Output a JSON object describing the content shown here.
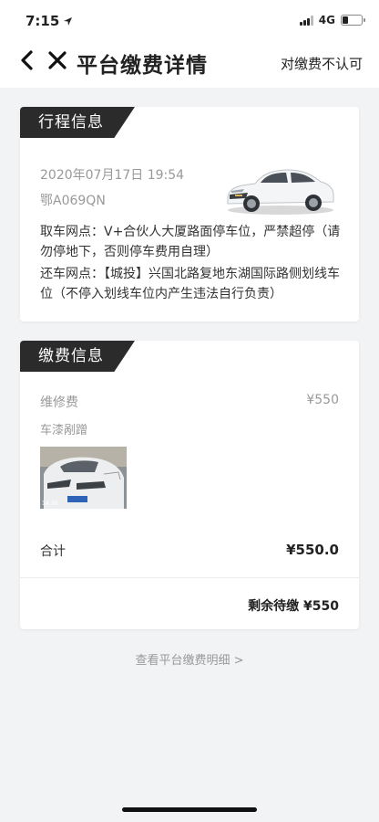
{
  "status_bar": {
    "time": "7:15",
    "network": "4G"
  },
  "nav": {
    "title": "平台缴费详情",
    "action": "对缴费不认可"
  },
  "trip": {
    "section_title": "行程信息",
    "datetime": "2020年07月17日 19:54",
    "plate": "鄂A069QN",
    "pickup": "取车网点：V+合伙人大厦路面停车位，严禁超停（请勿停地下，否则停车费用自理）",
    "return": "还车网点：【城投】兴国北路复地东湖国际路侧划线车位（不停入划线车位内产生违法自行负责）"
  },
  "payment": {
    "section_title": "缴费信息",
    "repair_label": "维修费",
    "repair_value": "¥550",
    "damage_label": "车漆剐蹭",
    "photo_timestamp": "14:36",
    "total_label": "合计",
    "total_value": "¥550.0",
    "remaining": "剩余待缴 ¥550"
  },
  "detail_link": "查看平台缴费明细 >"
}
